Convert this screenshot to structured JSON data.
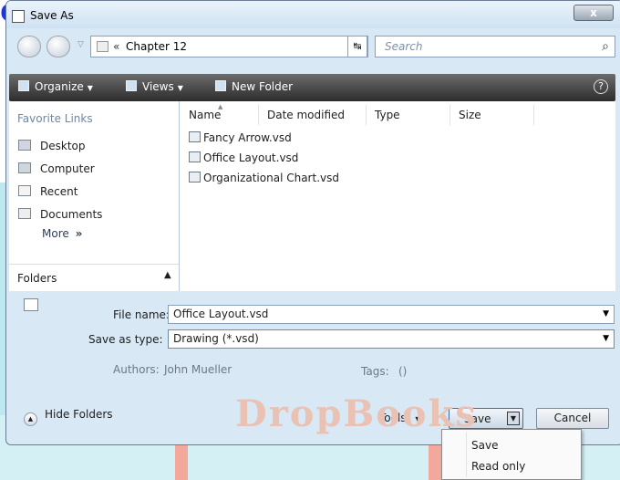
{
  "background": {
    "watermark_text": "DropBooks",
    "corner_text": "oks"
  },
  "window": {
    "title": "Save As",
    "close_glyph": "x"
  },
  "address_bar": {
    "chevron": "«",
    "path": "Chapter 12",
    "search_placeholder": "Search"
  },
  "toolbar": {
    "organize_label": "Organize",
    "views_label": "Views",
    "new_folder_label": "New Folder",
    "help_glyph": "?"
  },
  "sidebar": {
    "heading": "Favorite Links",
    "items": [
      {
        "label": "Desktop",
        "icon": "desktop-icon"
      },
      {
        "label": "Computer",
        "icon": "computer-icon"
      },
      {
        "label": "Recent",
        "icon": "recent-icon"
      },
      {
        "label": "Documents",
        "icon": "documents-icon"
      }
    ],
    "more_label": "More",
    "more_glyph": "»",
    "folders_label": "Folders"
  },
  "file_list": {
    "columns": [
      "Name",
      "Date modified",
      "Type",
      "Size"
    ],
    "files": [
      "Fancy Arrow.vsd",
      "Office Layout.vsd",
      "Organizational Chart.vsd"
    ]
  },
  "form": {
    "file_name_label": "File name:",
    "file_name_value": "Office Layout.vsd",
    "save_type_label": "Save as type:",
    "save_type_value": "Drawing (*.vsd)",
    "authors_label": "Authors:",
    "authors_value": "John Mueller",
    "tags_label": "Tags:",
    "tags_value": "()"
  },
  "footer": {
    "hide_folders_label": "Hide Folders",
    "tools_label": "Tools",
    "save_label": "Save",
    "cancel_label": "Cancel"
  },
  "save_menu": {
    "items": [
      "Save",
      "Read only"
    ]
  }
}
